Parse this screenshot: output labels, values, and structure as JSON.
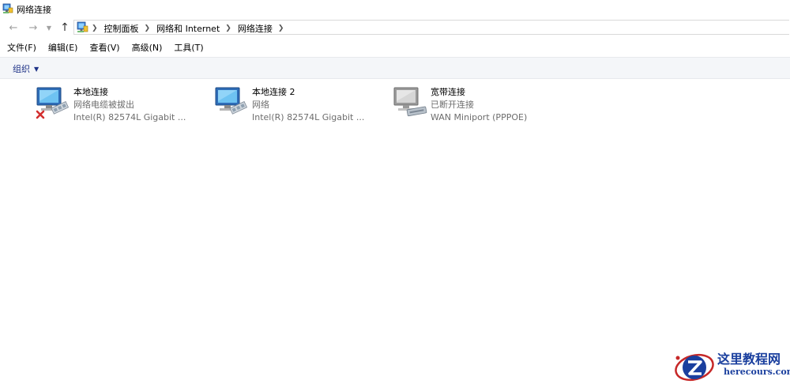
{
  "window": {
    "title": "网络连接"
  },
  "address": {
    "breadcrumbs": [
      "控制面板",
      "网络和 Internet",
      "网络连接"
    ]
  },
  "menu": {
    "items": [
      "文件(F)",
      "编辑(E)",
      "查看(V)",
      "高级(N)",
      "工具(T)"
    ]
  },
  "commandbar": {
    "organize_label": "组织"
  },
  "connections": [
    {
      "name": "本地连接",
      "status": "网络电缆被拔出",
      "device": "Intel(R) 82574L Gigabit ...",
      "state": "disconnected-cable"
    },
    {
      "name": "本地连接 2",
      "status": "网络",
      "device": "Intel(R) 82574L Gigabit ...",
      "state": "connected"
    },
    {
      "name": "宽带连接",
      "status": "已断开连接",
      "device": "WAN Miniport (PPPOE)",
      "state": "disconnected"
    }
  ],
  "watermark": {
    "title": "这里教程网",
    "url": "herecours.com"
  },
  "colors": {
    "link_blue": "#1e3287",
    "error_red": "#d32f2f",
    "watermark_blue": "#1a3f9e"
  }
}
